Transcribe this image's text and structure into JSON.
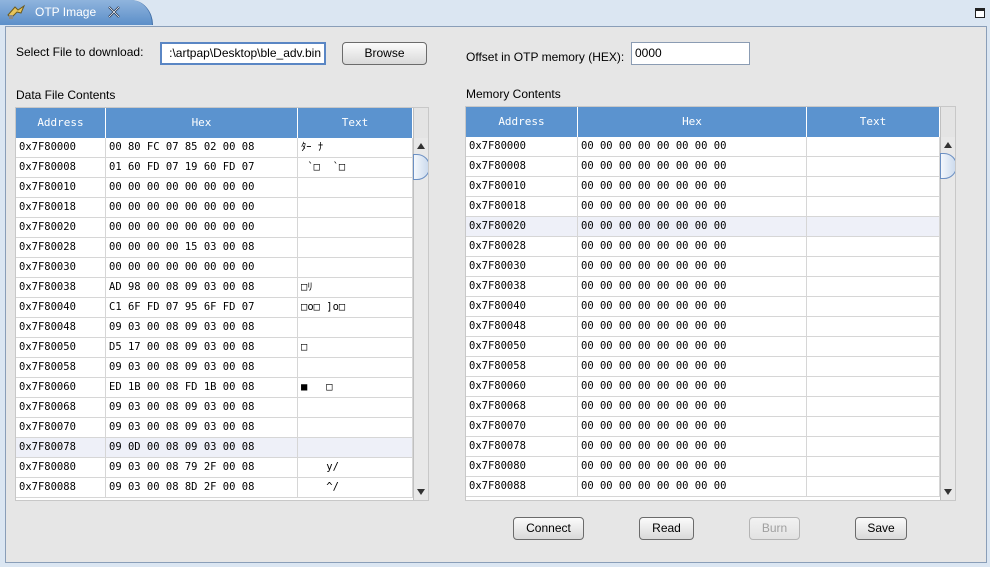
{
  "tab": {
    "title": "OTP Image",
    "icon": "chip-icon",
    "close_icon": "close-x-icon"
  },
  "form": {
    "select_file_label": "Select File to download:",
    "file_path": ":\\artpap\\Desktop\\ble_adv.bin",
    "browse_label": "Browse",
    "offset_label": "Offset in OTP memory (HEX):",
    "offset_value": "0000"
  },
  "data_table": {
    "title": "Data File Contents",
    "headers": [
      "Address",
      "Hex",
      "Text"
    ],
    "selected_row": 15,
    "rows": [
      [
        "0x7F80000",
        "00 80 FC 07 85 02 00 08",
        "ﾀｰ ﾅ"
      ],
      [
        "0x7F80008",
        "01 60 FD 07 19 60 FD 07",
        " `□  `□"
      ],
      [
        "0x7F80010",
        "00 00 00 00 00 00 00 00",
        ""
      ],
      [
        "0x7F80018",
        "00 00 00 00 00 00 00 00",
        ""
      ],
      [
        "0x7F80020",
        "00 00 00 00 00 00 00 00",
        ""
      ],
      [
        "0x7F80028",
        "00 00 00 00 15 03 00 08",
        ""
      ],
      [
        "0x7F80030",
        "00 00 00 00 00 00 00 00",
        ""
      ],
      [
        "0x7F80038",
        "AD 98 00 08 09 03 00 08",
        "□ﾘ"
      ],
      [
        "0x7F80040",
        "C1 6F FD 07 95 6F FD 07",
        "□o□ ]o□"
      ],
      [
        "0x7F80048",
        "09 03 00 08 09 03 00 08",
        ""
      ],
      [
        "0x7F80050",
        "D5 17 00 08 09 03 00 08",
        "□"
      ],
      [
        "0x7F80058",
        "09 03 00 08 09 03 00 08",
        ""
      ],
      [
        "0x7F80060",
        "ED 1B 00 08 FD 1B 00 08",
        "■   □"
      ],
      [
        "0x7F80068",
        "09 03 00 08 09 03 00 08",
        ""
      ],
      [
        "0x7F80070",
        "09 03 00 08 09 03 00 08",
        ""
      ],
      [
        "0x7F80078",
        "09 0D 00 08 09 03 00 08",
        ""
      ],
      [
        "0x7F80080",
        "09 03 00 08 79 2F 00 08",
        "    y/"
      ],
      [
        "0x7F80088",
        "09 03 00 08 8D 2F 00 08",
        "    ^/"
      ]
    ]
  },
  "memory_table": {
    "title": "Memory Contents",
    "headers": [
      "Address",
      "Hex",
      "Text"
    ],
    "selected_row": 4,
    "rows": [
      [
        "0x7F80000",
        "00 00 00 00 00 00 00 00",
        ""
      ],
      [
        "0x7F80008",
        "00 00 00 00 00 00 00 00",
        ""
      ],
      [
        "0x7F80010",
        "00 00 00 00 00 00 00 00",
        ""
      ],
      [
        "0x7F80018",
        "00 00 00 00 00 00 00 00",
        ""
      ],
      [
        "0x7F80020",
        "00 00 00 00 00 00 00 00",
        ""
      ],
      [
        "0x7F80028",
        "00 00 00 00 00 00 00 00",
        ""
      ],
      [
        "0x7F80030",
        "00 00 00 00 00 00 00 00",
        ""
      ],
      [
        "0x7F80038",
        "00 00 00 00 00 00 00 00",
        ""
      ],
      [
        "0x7F80040",
        "00 00 00 00 00 00 00 00",
        ""
      ],
      [
        "0x7F80048",
        "00 00 00 00 00 00 00 00",
        ""
      ],
      [
        "0x7F80050",
        "00 00 00 00 00 00 00 00",
        ""
      ],
      [
        "0x7F80058",
        "00 00 00 00 00 00 00 00",
        ""
      ],
      [
        "0x7F80060",
        "00 00 00 00 00 00 00 00",
        ""
      ],
      [
        "0x7F80068",
        "00 00 00 00 00 00 00 00",
        ""
      ],
      [
        "0x7F80070",
        "00 00 00 00 00 00 00 00",
        ""
      ],
      [
        "0x7F80078",
        "00 00 00 00 00 00 00 00",
        ""
      ],
      [
        "0x7F80080",
        "00 00 00 00 00 00 00 00",
        ""
      ],
      [
        "0x7F80088",
        "00 00 00 00 00 00 00 00",
        ""
      ]
    ]
  },
  "buttons": {
    "connect": "Connect",
    "read": "Read",
    "burn": "Burn",
    "save": "Save"
  },
  "colors": {
    "header_blue": "#5b93cf",
    "tab_blue": "#5c8fc9",
    "panel_bg": "#e6e6e6"
  }
}
